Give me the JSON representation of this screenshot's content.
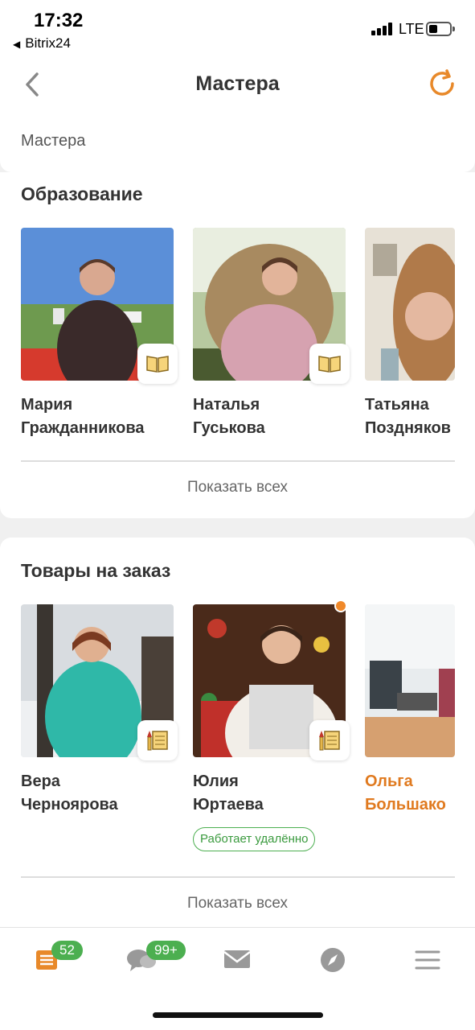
{
  "status_bar": {
    "time": "17:32",
    "back_app": "Bitrix24",
    "network": "LTE"
  },
  "header": {
    "title": "Мастера"
  },
  "breadcrumb": "Мастера",
  "sections": [
    {
      "title": "Образование",
      "show_all": "Показать всех",
      "people": [
        {
          "first": "Мария",
          "last": "Гражданникова",
          "badge": "book-icon"
        },
        {
          "first": "Наталья",
          "last": "Гуськова",
          "badge": "book-icon"
        },
        {
          "first": "Татьяна",
          "last": "Поздняков"
        }
      ]
    },
    {
      "title": "Товары на заказ",
      "show_all": "Показать всех",
      "people": [
        {
          "first": "Вера",
          "last": "Черноярова",
          "badge": "brush-canvas-icon"
        },
        {
          "first": "Юлия",
          "last": "Юртаева",
          "badge": "brush-canvas-icon",
          "tag": "Работает удалённо"
        },
        {
          "first": "Ольга",
          "last": "Большако"
        }
      ]
    }
  ],
  "tabbar": {
    "feed_count": "52",
    "chat_count": "99+"
  },
  "colors": {
    "accent": "#e07a1f",
    "green": "#4caf50"
  }
}
